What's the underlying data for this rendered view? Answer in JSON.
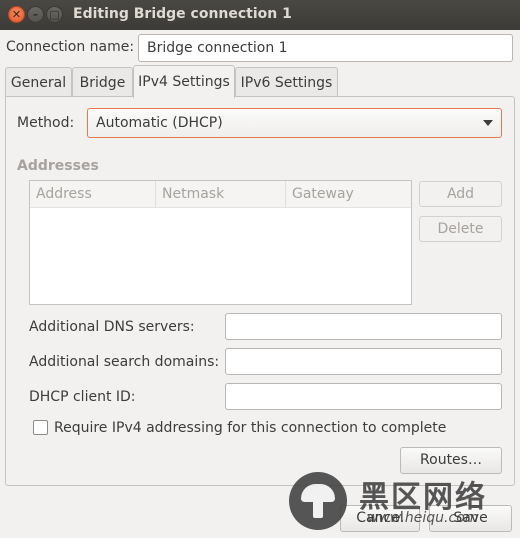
{
  "window": {
    "title": "Editing Bridge connection 1",
    "controls": {
      "close": "✕",
      "minimize": "–",
      "maximize": "□"
    }
  },
  "connection": {
    "name_label": "Connection name:",
    "name_value": "Bridge connection 1"
  },
  "tabs": [
    {
      "label": "General",
      "active": false
    },
    {
      "label": "Bridge",
      "active": false
    },
    {
      "label": "IPv4 Settings",
      "active": true
    },
    {
      "label": "IPv6 Settings",
      "active": false
    }
  ],
  "ipv4": {
    "method_label": "Method:",
    "method_value": "Automatic (DHCP)",
    "addresses_heading": "Addresses",
    "columns": [
      "Address",
      "Netmask",
      "Gateway"
    ],
    "rows": [],
    "add_label": "Add",
    "delete_label": "Delete",
    "dns_label": "Additional DNS servers:",
    "dns_value": "",
    "search_label": "Additional search domains:",
    "search_value": "",
    "dhcp_label": "DHCP client ID:",
    "dhcp_value": "",
    "require_label": "Require IPv4 addressing for this connection to complete",
    "require_checked": false,
    "routes_label": "Routes…"
  },
  "footer": {
    "cancel_label": "Cancel",
    "save_label": "Save"
  },
  "watermark": {
    "chinese": "黑区网络",
    "url": "www.heiqu.com"
  },
  "colors": {
    "titlebar": "#3c3b37",
    "close_button": "#e0562b",
    "focus_accent": "#e5794e",
    "window_bg": "#f2f1f0"
  }
}
